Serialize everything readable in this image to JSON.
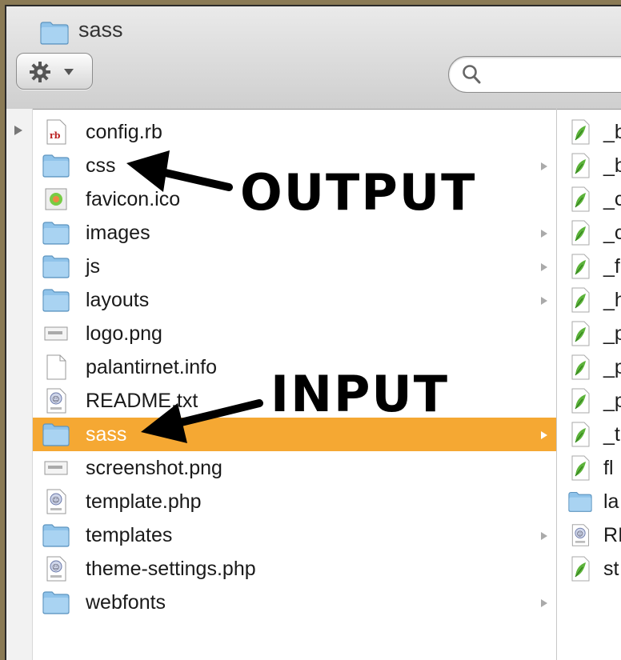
{
  "window": {
    "title": "sass"
  },
  "toolbar": {
    "action_icon": "gear-icon",
    "search": {
      "value": "",
      "placeholder": ""
    }
  },
  "column1": {
    "items": [
      {
        "name": "config.rb",
        "icon": "ruby-file-icon",
        "folder": false
      },
      {
        "name": "css",
        "icon": "folder-icon",
        "folder": true
      },
      {
        "name": "favicon.ico",
        "icon": "ico-file-icon",
        "folder": false
      },
      {
        "name": "images",
        "icon": "folder-icon",
        "folder": true
      },
      {
        "name": "js",
        "icon": "folder-icon",
        "folder": true
      },
      {
        "name": "layouts",
        "icon": "folder-icon",
        "folder": true
      },
      {
        "name": "logo.png",
        "icon": "image-file-icon",
        "folder": false
      },
      {
        "name": "palantirnet.info",
        "icon": "blank-file-icon",
        "folder": false
      },
      {
        "name": "README.txt",
        "icon": "php-file-icon",
        "folder": false
      },
      {
        "name": "sass",
        "icon": "folder-icon",
        "folder": true,
        "selected": true
      },
      {
        "name": "screenshot.png",
        "icon": "image-file-icon",
        "folder": false
      },
      {
        "name": "template.php",
        "icon": "php-file-icon",
        "folder": false
      },
      {
        "name": "templates",
        "icon": "folder-icon",
        "folder": true
      },
      {
        "name": "theme-settings.php",
        "icon": "php-file-icon",
        "folder": false
      },
      {
        "name": "webfonts",
        "icon": "folder-icon",
        "folder": true
      }
    ]
  },
  "column2": {
    "items": [
      {
        "name": "_b",
        "icon": "scss-file-icon"
      },
      {
        "name": "_b",
        "icon": "scss-file-icon"
      },
      {
        "name": "_c",
        "icon": "scss-file-icon"
      },
      {
        "name": "_c",
        "icon": "scss-file-icon"
      },
      {
        "name": "_f",
        "icon": "scss-file-icon"
      },
      {
        "name": "_h",
        "icon": "scss-file-icon"
      },
      {
        "name": "_p",
        "icon": "scss-file-icon"
      },
      {
        "name": "_p",
        "icon": "scss-file-icon"
      },
      {
        "name": "_p",
        "icon": "scss-file-icon"
      },
      {
        "name": "_t",
        "icon": "scss-file-icon"
      },
      {
        "name": "fl",
        "icon": "scss-file-icon"
      },
      {
        "name": "la",
        "icon": "folder-icon"
      },
      {
        "name": "RI",
        "icon": "php-file-icon"
      },
      {
        "name": "st",
        "icon": "scss-file-icon"
      }
    ]
  },
  "annotations": {
    "output": "OUTPUT",
    "input": "INPUT"
  },
  "colors": {
    "selection": "#f5a833",
    "folder": "#8fc3ea",
    "scss_leaf": "#5cb33a"
  }
}
